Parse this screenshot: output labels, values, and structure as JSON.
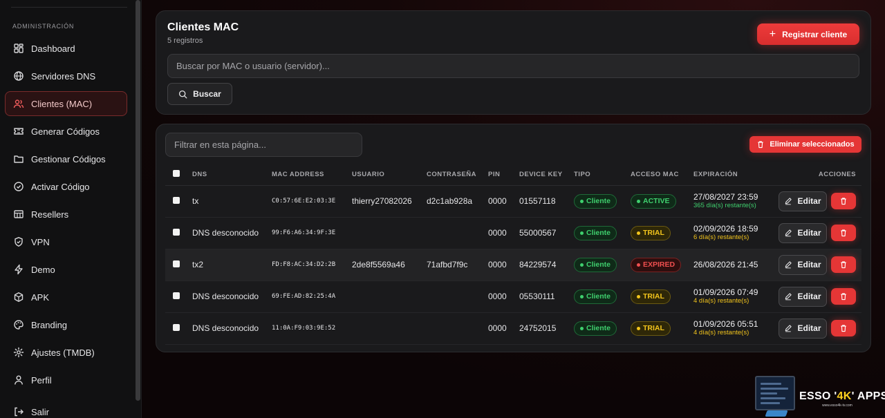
{
  "sidebar": {
    "section_label": "ADMINISTRACIÓN",
    "items": [
      {
        "label": "Dashboard",
        "icon": "dashboard-icon",
        "active": false
      },
      {
        "label": "Servidores DNS",
        "icon": "globe-icon",
        "active": false
      },
      {
        "label": "Clientes (MAC)",
        "icon": "users-icon",
        "active": true
      },
      {
        "label": "Generar Códigos",
        "icon": "ticket-icon",
        "active": false
      },
      {
        "label": "Gestionar Códigos",
        "icon": "folder-icon",
        "active": false
      },
      {
        "label": "Activar Código",
        "icon": "check-circle-icon",
        "active": false
      },
      {
        "label": "Resellers",
        "icon": "store-icon",
        "active": false
      },
      {
        "label": "VPN",
        "icon": "shield-icon",
        "active": false
      },
      {
        "label": "Demo",
        "icon": "bolt-icon",
        "active": false
      },
      {
        "label": "APK",
        "icon": "package-icon",
        "active": false
      },
      {
        "label": "Branding",
        "icon": "palette-icon",
        "active": false
      },
      {
        "label": "Ajustes (TMDB)",
        "icon": "gear-icon",
        "active": false
      },
      {
        "label": "Perfil",
        "icon": "user-icon",
        "active": false
      },
      {
        "label": "Salir",
        "icon": "logout-icon",
        "active": false
      }
    ]
  },
  "header": {
    "title": "Clientes MAC",
    "subtitle": "5 registros",
    "register_label": "Registrar cliente",
    "search_placeholder": "Buscar por MAC o usuario (servidor)...",
    "search_button": "Buscar"
  },
  "table_card": {
    "filter_placeholder": "Filtrar en esta página...",
    "delete_selected_label": "Eliminar seleccionados",
    "columns": [
      "DNS",
      "MAC ADDRESS",
      "USUARIO",
      "CONTRASEÑA",
      "PIN",
      "DEVICE KEY",
      "TIPO",
      "ACCESO MAC",
      "EXPIRACIÓN",
      "ACCIONES"
    ],
    "edit_label": "Editar",
    "rows": [
      {
        "dns": "tx",
        "mac": "C0:57:6E:E2:03:3E",
        "usuario": "thierry27082026",
        "contrasena": "d2c1ab928a",
        "pin": "0000",
        "device_key": "01557118",
        "tipo": "Cliente",
        "acceso": "ACTIVE",
        "exp_date": "27/08/2027 23:59",
        "exp_left": "365 día(s) restante(s)"
      },
      {
        "dns": "DNS desconocido",
        "mac": "99:F6:A6:34:9F:3E",
        "usuario": "",
        "contrasena": "",
        "pin": "0000",
        "device_key": "55000567",
        "tipo": "Cliente",
        "acceso": "TRIAL",
        "exp_date": "02/09/2026 18:59",
        "exp_left": "6 día(s) restante(s)"
      },
      {
        "dns": "tx2",
        "mac": "FD:F8:AC:34:D2:2B",
        "usuario": "2de8f5569a46",
        "contrasena": "71afbd7f9c",
        "pin": "0000",
        "device_key": "84229574",
        "tipo": "Cliente",
        "acceso": "EXPIRED",
        "exp_date": "26/08/2026 21:45",
        "exp_left": ""
      },
      {
        "dns": "DNS desconocido",
        "mac": "69:FE:AD:82:25:4A",
        "usuario": "",
        "contrasena": "",
        "pin": "0000",
        "device_key": "05530111",
        "tipo": "Cliente",
        "acceso": "TRIAL",
        "exp_date": "01/09/2026 07:49",
        "exp_left": "4 día(s) restante(s)"
      },
      {
        "dns": "DNS desconocido",
        "mac": "11:0A:F9:03:9E:52",
        "usuario": "",
        "contrasena": "",
        "pin": "0000",
        "device_key": "24752015",
        "tipo": "Cliente",
        "acceso": "TRIAL",
        "exp_date": "01/09/2026 05:51",
        "exp_left": "4 día(s) restante(s)"
      }
    ]
  },
  "logo": {
    "text_before": "ESSO '",
    "text_highlight": "4K",
    "text_after": "' APPS",
    "url": "www.esso4k-tv.com"
  },
  "colors": {
    "accent": "#e53636",
    "success": "#3fd06e",
    "warning": "#f3c51c",
    "danger": "#f04f4f"
  }
}
